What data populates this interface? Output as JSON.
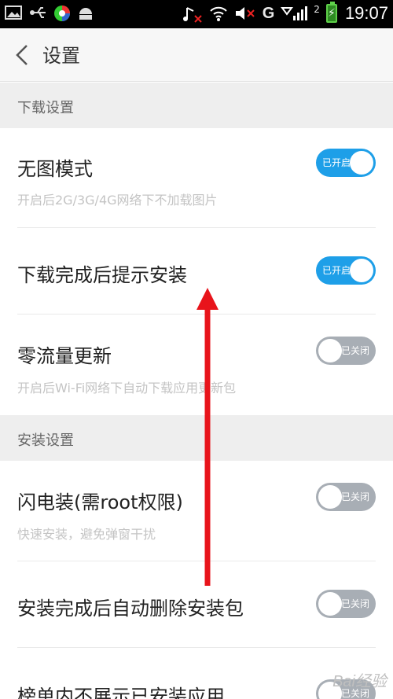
{
  "status_bar": {
    "time": "19:07",
    "network_type": "G",
    "signal_suffix": "2"
  },
  "header": {
    "title": "设置"
  },
  "sections": [
    {
      "label": "下载设置"
    },
    {
      "label": "安装设置"
    }
  ],
  "rows": [
    {
      "title": "无图模式",
      "desc": "开启后2G/3G/4G网络下不加载图片",
      "toggle_on": true,
      "toggle_label": "已开启"
    },
    {
      "title": "下载完成后提示安装",
      "desc": "",
      "toggle_on": true,
      "toggle_label": "已开启"
    },
    {
      "title": "零流量更新",
      "desc": "开启后Wi-Fi网络下自动下载应用更新包",
      "toggle_on": false,
      "toggle_label": "已关闭"
    },
    {
      "title": "闪电装(需root权限)",
      "desc": "快速安装，避免弹窗干扰",
      "toggle_on": false,
      "toggle_label": "已关闭"
    },
    {
      "title": "安装完成后自动删除安装包",
      "desc": "",
      "toggle_on": false,
      "toggle_label": "已关闭"
    },
    {
      "title": "榜单内不展示已安装应用",
      "desc": "",
      "toggle_on": false,
      "toggle_label": "已关闭"
    }
  ],
  "colors": {
    "toggle_on": "#1e9fe8",
    "toggle_off": "#a8aeb5",
    "annotation_arrow": "#e8141b"
  },
  "watermark": "Bai经验"
}
